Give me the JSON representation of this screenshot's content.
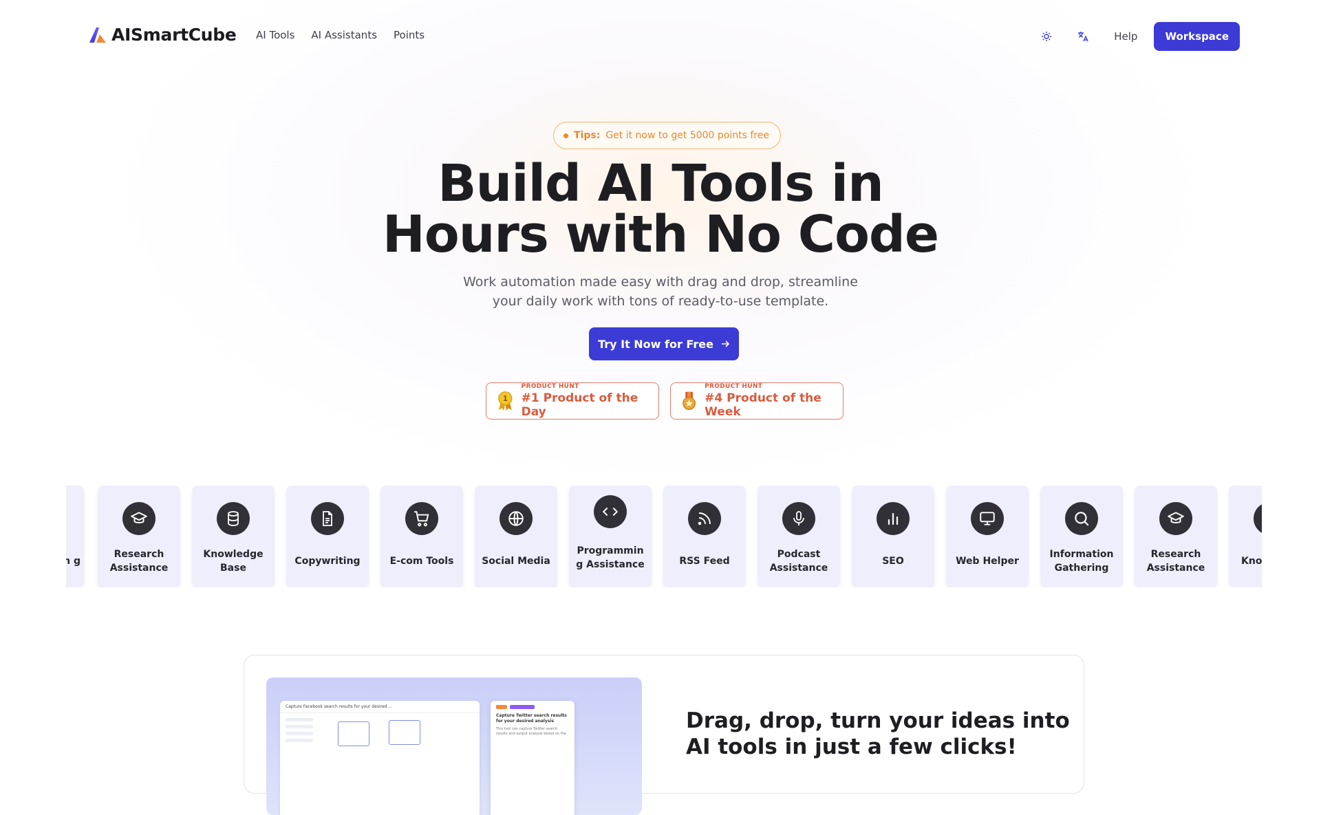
{
  "header": {
    "brand": "AISmartCube",
    "nav": [
      "AI Tools",
      "AI Assistants",
      "Points"
    ],
    "theme_icon": "sun-icon",
    "language_icon": "translate-icon",
    "help_label": "Help",
    "workspace_label": "Workspace"
  },
  "hero": {
    "tips_label": "Tips:",
    "tips_text": "Get it now to get 5000 points free",
    "title_line1": "Build AI Tools in",
    "title_line2": "Hours with No Code",
    "subtitle_line1": "Work automation made easy with drag and drop, streamline",
    "subtitle_line2": "your daily work with tons of ready-to-use template.",
    "cta_label": "Try It Now for Free",
    "badges": [
      {
        "kicker": "PRODUCT HUNT",
        "title": "#1 Product of the Day",
        "icon": "gold-medal-icon"
      },
      {
        "kicker": "PRODUCT HUNT",
        "title": "#4 Product of the Week",
        "icon": "bronze-medal-icon"
      }
    ]
  },
  "categories": [
    {
      "label": "n g",
      "icon": "partial-icon"
    },
    {
      "label": "Research Assistance",
      "icon": "graduation-cap-icon"
    },
    {
      "label": "Knowledge Base",
      "icon": "database-icon"
    },
    {
      "label": "Copywriting",
      "icon": "document-icon"
    },
    {
      "label": "E-com Tools",
      "icon": "shopping-cart-icon"
    },
    {
      "label": "Social Media",
      "icon": "globe-icon"
    },
    {
      "label": "Programming Assistance",
      "icon": "code-icon"
    },
    {
      "label": "RSS Feed",
      "icon": "rss-icon"
    },
    {
      "label": "Podcast Assistance",
      "icon": "microphone-icon"
    },
    {
      "label": "SEO",
      "icon": "bar-chart-icon"
    },
    {
      "label": "Web Helper",
      "icon": "monitor-icon"
    },
    {
      "label": "Information Gathering",
      "icon": "search-icon"
    },
    {
      "label": "Research Assistance",
      "icon": "graduation-cap-icon"
    },
    {
      "label": "Know B",
      "icon": "database-icon"
    }
  ],
  "feature": {
    "title": "Drag, drop, turn your ideas into AI tools in just a few clicks!",
    "mock_header": "Capture Facebook search results for your desired ...",
    "mock_card_title": "Capture Twitter search results for your desired analysis",
    "mock_card_text": "This tool can capture Twitter search results and output analysis based on the"
  },
  "colors": {
    "primary": "#3c3bd6",
    "tips_accent": "#e8892b",
    "badge_accent": "#da5b3f",
    "card_bg": "#eeeefc"
  }
}
